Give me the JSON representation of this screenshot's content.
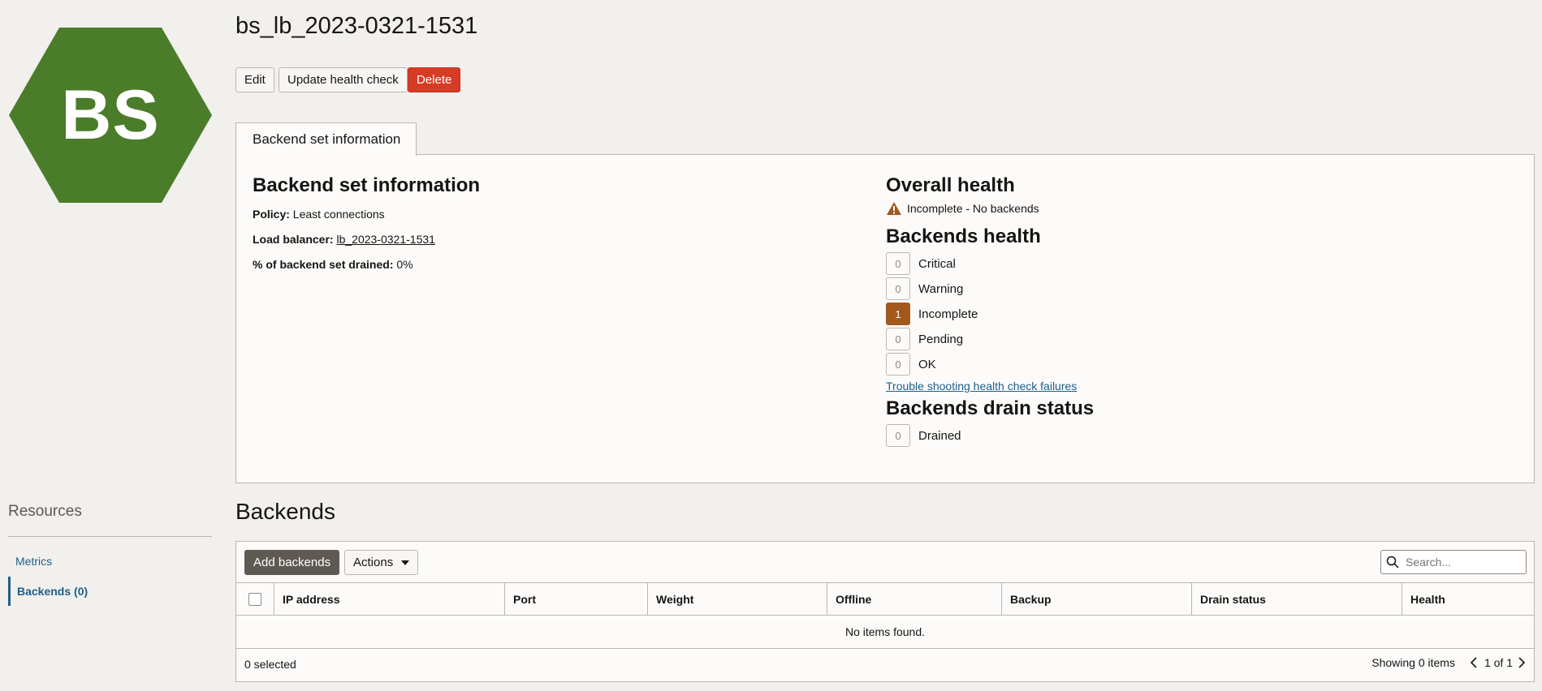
{
  "avatar": {
    "initials": "BS",
    "color": "#4b7c2a"
  },
  "page": {
    "title": "bs_lb_2023-0321-1531"
  },
  "actions": {
    "edit": "Edit",
    "update_health_check": "Update health check",
    "delete": "Delete"
  },
  "tabs": [
    {
      "label": "Backend set information"
    }
  ],
  "info": {
    "heading": "Backend set information",
    "policy_label": "Policy:",
    "policy_value": "Least connections",
    "lb_label": "Load balancer:",
    "lb_value": "lb_2023-0321-1531",
    "drained_label": "% of backend set drained:",
    "drained_value": "0%"
  },
  "overall_health": {
    "heading": "Overall health",
    "status": "Incomplete - No backends",
    "icon": "warning-icon",
    "color": "#a3581c"
  },
  "backends_health": {
    "heading": "Backends health",
    "rows": [
      {
        "count": "0",
        "label": "Critical"
      },
      {
        "count": "0",
        "label": "Warning"
      },
      {
        "count": "1",
        "label": "Incomplete"
      },
      {
        "count": "0",
        "label": "Pending"
      },
      {
        "count": "0",
        "label": "OK"
      }
    ],
    "troubleshoot_link": "Trouble shooting health check failures"
  },
  "drain_status": {
    "heading": "Backends drain status",
    "rows": [
      {
        "count": "0",
        "label": "Drained"
      }
    ]
  },
  "resources": {
    "title": "Resources",
    "items": [
      {
        "label": "Metrics"
      },
      {
        "label": "Backends (0)"
      }
    ]
  },
  "backends": {
    "title": "Backends",
    "add_button": "Add backends",
    "actions_button": "Actions",
    "search_placeholder": "Search...",
    "columns": [
      "IP address",
      "Port",
      "Weight",
      "Offline",
      "Backup",
      "Drain status",
      "Health"
    ],
    "empty_message": "No items found.",
    "selected_count": "0 selected",
    "showing": "Showing 0 items",
    "pagination": "1 of 1"
  }
}
